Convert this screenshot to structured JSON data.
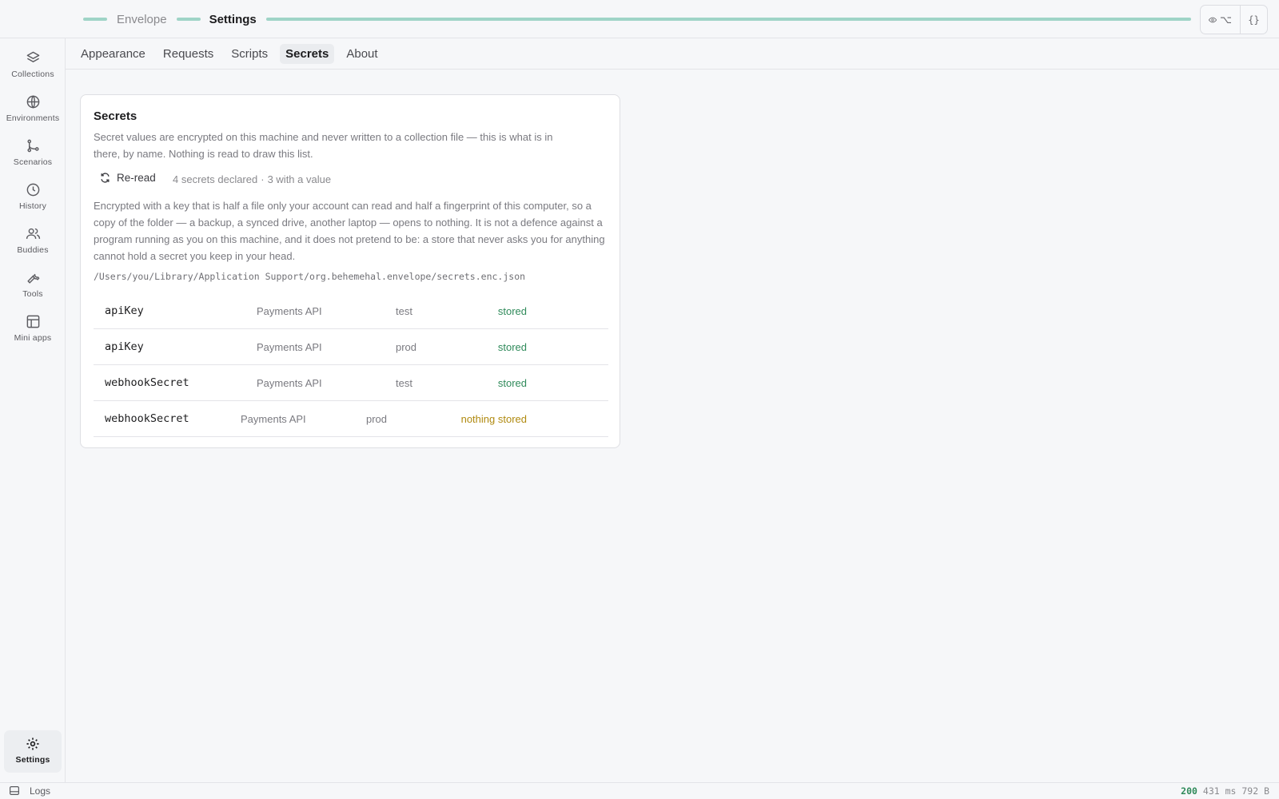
{
  "header": {
    "app_name": "Envelope",
    "page_name": "Settings",
    "action_eye_suffix": "⌥",
    "action_json": "{}"
  },
  "sidebar": {
    "items": [
      {
        "label": "Collections",
        "icon": "layers-icon"
      },
      {
        "label": "Environments",
        "icon": "globe-icon"
      },
      {
        "label": "Scenarios",
        "icon": "branch-icon"
      },
      {
        "label": "History",
        "icon": "clock-icon"
      },
      {
        "label": "Buddies",
        "icon": "users-icon"
      },
      {
        "label": "Tools",
        "icon": "wrench-icon"
      },
      {
        "label": "Mini apps",
        "icon": "layout-icon"
      }
    ],
    "settings_label": "Settings"
  },
  "tabs": [
    {
      "label": "Appearance"
    },
    {
      "label": "Requests"
    },
    {
      "label": "Scripts"
    },
    {
      "label": "Secrets",
      "active": true
    },
    {
      "label": "About"
    }
  ],
  "secrets": {
    "title": "Secrets",
    "description": "Secret values are encrypted on this machine and never written to a collection file — this is what is in there, by name. Nothing is read to draw this list.",
    "reread_label": "Re-read",
    "declared_count": "4 secrets declared",
    "separator": "·",
    "value_count": "3 with a value",
    "note": "Encrypted with a key that is half a file only your account can read and half a fingerprint of this computer, so a copy of the folder — a backup, a synced drive, another laptop — opens to nothing. It is not a defence against a program running as you on this machine, and it does not pretend to be: a store that never asks you for anything cannot hold a secret you keep in your head.",
    "path": "/Users/you/Library/Application Support/org.behemehal.envelope/secrets.enc.json",
    "rows": [
      {
        "name": "apiKey",
        "collection": "Payments API",
        "env": "test",
        "status": "stored"
      },
      {
        "name": "apiKey",
        "collection": "Payments API",
        "env": "prod",
        "status": "stored"
      },
      {
        "name": "webhookSecret",
        "collection": "Payments API",
        "env": "test",
        "status": "stored"
      },
      {
        "name": "webhookSecret",
        "collection": "Payments API",
        "env": "prod",
        "status": "nothing stored"
      }
    ]
  },
  "statusbar": {
    "logs_label": "Logs",
    "code": "200",
    "timing": "431 ms",
    "size": "792 B"
  },
  "colors": {
    "accent": "#9fd4c7",
    "stored": "#2f8a5a",
    "nothing_stored": "#b08a10"
  }
}
